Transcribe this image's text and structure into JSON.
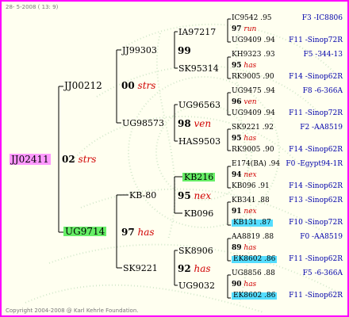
{
  "header": {
    "date": "28- 5-2008 ( 13: 9)"
  },
  "footer": {
    "copyright": "Copyright 2004-2008 @ Karl Kehrle Foundation."
  },
  "colors": {
    "border": "#ff00ff",
    "proband": "#ff99ff",
    "highlight_green": "#66ee66",
    "highlight_cyan": "#55ddff",
    "accent_red": "#d00000",
    "link_blue": "#0000aa"
  },
  "gen1": {
    "id": "JJ02411"
  },
  "gen2": {
    "sire": {
      "num": "02",
      "mark": "strs"
    }
  },
  "gen3": {
    "a": {
      "id": "JJ00212"
    },
    "b": {
      "id": "UG9714"
    }
  },
  "gen4": {
    "a": {
      "num": "00",
      "mark": "strs"
    },
    "b": {
      "num": "97",
      "mark": "has"
    }
  },
  "gen5": {
    "a": {
      "id": "JJ99303"
    },
    "b": {
      "id": "UG98573"
    },
    "c": {
      "id": "KB-80"
    },
    "d": {
      "id": "SK9221"
    }
  },
  "gen6": {
    "a": {
      "num": "99",
      "mark": ""
    },
    "b": {
      "num": "98",
      "mark": "ven"
    },
    "c": {
      "num": "95",
      "mark": "nex"
    },
    "d": {
      "num": "92",
      "mark": "has"
    }
  },
  "gen7": {
    "a": {
      "id": "IA97217"
    },
    "b": {
      "id": "SK95314"
    },
    "c": {
      "id": "UG96563"
    },
    "d": {
      "id": "HAS9503"
    },
    "e": {
      "id": "KB216"
    },
    "f": {
      "id": "KB096"
    },
    "g": {
      "id": "SK8906"
    },
    "h": {
      "id": "UG9032"
    }
  },
  "gen8": [
    {
      "top": "IC9542 .95",
      "num": "97",
      "mark": "run",
      "bot": "UG9409 .94",
      "top_link": "F3 -IC8806",
      "bot_link": "F11 -Sinop72R"
    },
    {
      "top": "KH9323 .93",
      "num": "95",
      "mark": "has",
      "bot": "RK9005 .90",
      "top_link": "F5 -344-13",
      "bot_link": "F14 -Sinop62R"
    },
    {
      "top": "UG9475 .94",
      "num": "96",
      "mark": "ven",
      "bot": "UG9409 .94",
      "top_link": "F8 -6-366A",
      "bot_link": "F11 -Sinop72R"
    },
    {
      "top": "SK9221 .92",
      "num": "95",
      "mark": "has",
      "bot": "RK9005 .90",
      "top_link": "F2 -AA8519",
      "bot_link": "F14 -Sinop62R"
    },
    {
      "top": "E174(BA) .94",
      "num": "94",
      "mark": "nex",
      "bot": "KB096 .91",
      "top_link": "F0 -Egypt94-1R",
      "bot_link": "F14 -Sinop62R"
    },
    {
      "top": "KB341 .88",
      "num": "91",
      "mark": "nex",
      "bot": "KB131 .87",
      "top_link": "F13 -Sinop62R",
      "bot_link": "F10 -Sinop72R"
    },
    {
      "top": "AA8819 .88",
      "num": "89",
      "mark": "has",
      "bot": "EK8602 .86",
      "top_link": "F0 -AA8519",
      "bot_link": "F11 -Sinop62R"
    },
    {
      "top": "UG8856 .88",
      "num": "90",
      "mark": "has",
      "bot": "EK8602 .86",
      "top_link": "F5 -6-366A",
      "bot_link": "F11 -Sinop62R"
    }
  ]
}
